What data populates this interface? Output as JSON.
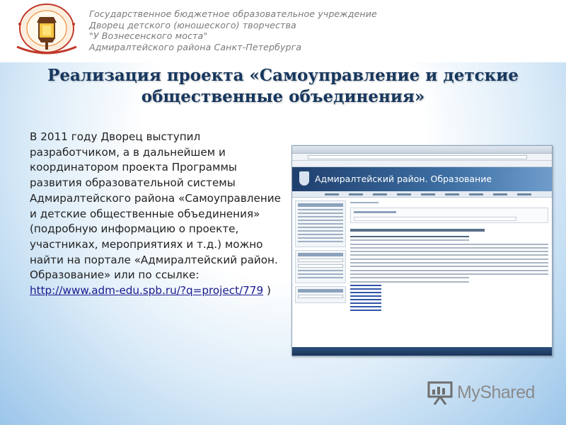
{
  "header": {
    "org_lines": [
      "Государственное бюджетное образовательное учреждение",
      "Дворец детского (юношеского) творчества",
      "\"У Вознесенского моста\"",
      "Адмиралтейского района Санкт-Петербурга"
    ],
    "logo_icon": "lantern-seal-icon",
    "logo_text": "Детский Дворец Творчества · У Вознесенского моста"
  },
  "slide": {
    "title_line1": "Реализация проекта «Самоуправление и детские",
    "title_line2": "общественные объединения»",
    "body_text": "В 2011 году Дворец выступил разработчиком, а в дальнейшем и координатором проекта Программы развития образовательной системы Адмиралтейского района «Самоуправление и детские общественные объединения» (подробную информацию о проекте, участниках, мероприятиях и т.д.) можно найти на портале «Адмиралтейский район. Образование» или по ссылке: ",
    "link_text": "http://www.adm-edu.spb.ru/?q=project/779",
    "body_tail": " )"
  },
  "screenshot": {
    "site_title": "Адмиралтейский район. Образование"
  },
  "watermark": {
    "text": "MyShared",
    "icon": "presentation-board-icon"
  },
  "colors": {
    "title": "#17375e",
    "header_text": "#7a7a7a",
    "link": "#1a1a8c",
    "background_edge": "#9cc6ea"
  }
}
